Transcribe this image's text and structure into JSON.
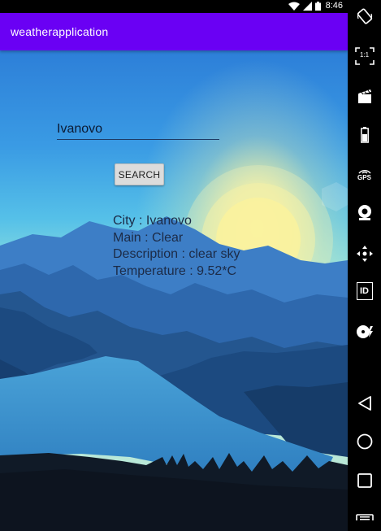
{
  "status_bar": {
    "time": "8:46"
  },
  "app_bar": {
    "title": "weatherapplication"
  },
  "search": {
    "city_value": "Ivanovo",
    "button_label": "SEARCH"
  },
  "result": {
    "city": "City : Ivanovo",
    "main": "Main : Clear",
    "description": "Description : clear sky",
    "temperature": "Temperature : 9.52*C"
  },
  "side_bar": {
    "icons": [
      "rotate-icon",
      "fullscreen-icon",
      "clapper-icon",
      "battery-icon",
      "gps-icon",
      "webcam-icon",
      "move-icon",
      "id-icon",
      "media-icon",
      "back-icon",
      "home-icon",
      "recents-icon",
      "menu-icon"
    ],
    "gps_label": "GPS",
    "id_label": "ID",
    "ratio_label": "1:1"
  }
}
